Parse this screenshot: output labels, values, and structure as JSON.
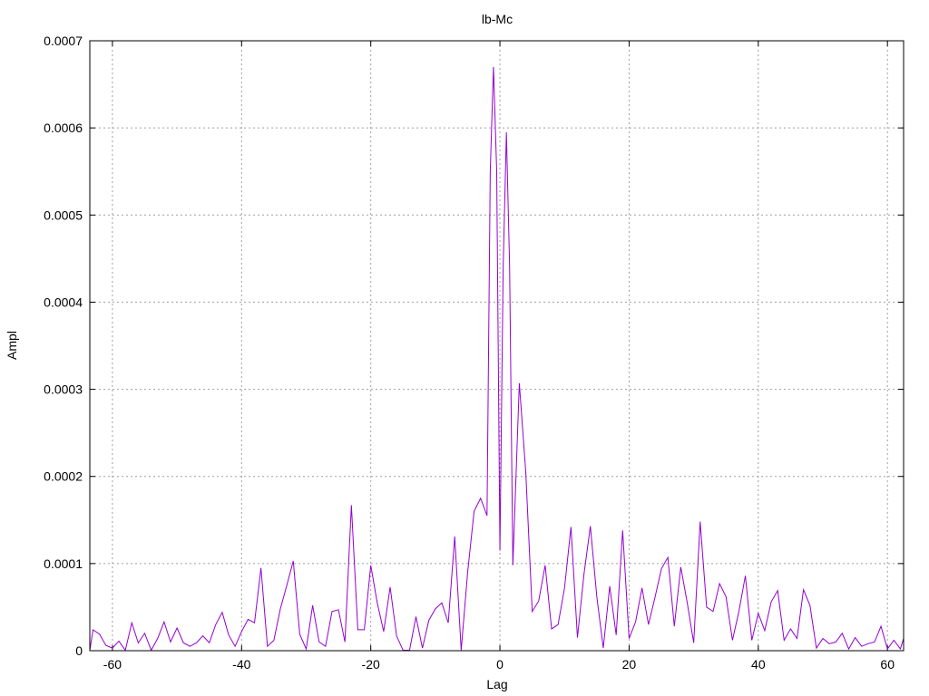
{
  "chart_data": {
    "type": "line",
    "title": "lb-Mc",
    "xlabel": "Lag",
    "ylabel": "Ampl",
    "xlim": [
      -63.5,
      62.5
    ],
    "ylim": [
      0,
      0.0007
    ],
    "grid": true,
    "x_ticks": [
      -60,
      -40,
      -20,
      0,
      20,
      40,
      60
    ],
    "x_tick_labels": [
      "-60",
      "-40",
      "-20",
      "0",
      "20",
      "40",
      "60"
    ],
    "y_ticks": [
      0,
      0.0001,
      0.0002,
      0.0003,
      0.0004,
      0.0005,
      0.0006,
      0.0007
    ],
    "y_tick_labels": [
      "0",
      "0.0001",
      "0.0002",
      "0.0003",
      "0.0004",
      "0.0005",
      "0.0006",
      "0.0007"
    ],
    "line_color": "#9400d3",
    "series": [
      {
        "x": [
          -63.5,
          -63,
          -62,
          -61,
          -60,
          -59,
          -58,
          -57,
          -56,
          -55,
          -54,
          -53,
          -52,
          -51,
          -50,
          -49,
          -48,
          -47,
          -46,
          -45,
          -44,
          -43,
          -42,
          -41,
          -40,
          -39,
          -38,
          -37,
          -36,
          -35,
          -34,
          -33,
          -32,
          -31,
          -30,
          -29,
          -28,
          -27,
          -26,
          -25,
          -24,
          -23,
          -22,
          -21,
          -20,
          -19,
          -18,
          -17,
          -16,
          -15,
          -14,
          -13,
          -12,
          -11,
          -10,
          -9,
          -8,
          -7,
          -6,
          -5,
          -4,
          -3,
          -2,
          -1.5,
          -1,
          -0.5,
          0,
          0.5,
          1,
          1.5,
          2,
          3,
          4,
          5,
          6,
          7,
          8,
          9,
          10,
          11,
          12,
          13,
          14,
          15,
          16,
          17,
          18,
          19,
          20,
          21,
          22,
          23,
          24,
          25,
          26,
          27,
          28,
          29,
          30,
          31,
          32,
          33,
          34,
          35,
          36,
          37,
          38,
          39,
          40,
          41,
          42,
          43,
          44,
          45,
          46,
          47,
          48,
          49,
          50,
          51,
          52,
          53,
          54,
          55,
          56,
          57,
          58,
          59,
          60,
          61,
          62,
          62.5
        ],
        "values": [
          5e-07,
          2.4e-05,
          1.9e-05,
          6e-06,
          3e-06,
          1.1e-05,
          5e-07,
          3.2e-05,
          9e-06,
          2e-05,
          5e-07,
          1.4e-05,
          3.3e-05,
          1e-05,
          2.6e-05,
          9e-06,
          5e-06,
          9e-06,
          1.7e-05,
          9e-06,
          3e-05,
          4.4e-05,
          1.8e-05,
          5e-06,
          2.2e-05,
          3.6e-05,
          3.2e-05,
          9.5e-05,
          5e-06,
          1.2e-05,
          4.8e-05,
          7.5e-05,
          0.000103,
          1.9e-05,
          2e-06,
          5.2e-05,
          1e-05,
          5e-06,
          4.5e-05,
          4.7e-05,
          1e-05,
          0.000167,
          2.4e-05,
          2.4e-05,
          9.8e-05,
          5.5e-05,
          2.2e-05,
          7.3e-05,
          1.7e-05,
          5e-07,
          5e-07,
          3.9e-05,
          3e-06,
          3.5e-05,
          4.8e-05,
          5.5e-05,
          3.2e-05,
          0.000131,
          5e-07,
          9e-05,
          0.00016,
          0.000175,
          0.000155,
          0.00055,
          0.00067,
          0.00055,
          0.000115,
          0.00044,
          0.000595,
          0.00044,
          9.8e-05,
          0.000307,
          0.000205,
          4.5e-05,
          5.7e-05,
          9.8e-05,
          2.5e-05,
          3e-05,
          7.2e-05,
          0.000142,
          1.5e-05,
          8.7e-05,
          0.000143,
          6.2e-05,
          3e-06,
          7.4e-05,
          1.8e-05,
          0.000138,
          1.4e-05,
          3.3e-05,
          7.2e-05,
          3e-05,
          6.1e-05,
          9.4e-05,
          0.000107,
          2.8e-05,
          9.6e-05,
          5.5e-05,
          9e-06,
          0.000148,
          5e-05,
          4.5e-05,
          7.7e-05,
          6.2e-05,
          1.2e-05,
          4.5e-05,
          8.6e-05,
          1.2e-05,
          4.3e-05,
          2.3e-05,
          5.6e-05,
          6.9e-05,
          1.2e-05,
          2.5e-05,
          1.4e-05,
          7e-05,
          5.2e-05,
          3e-06,
          1.4e-05,
          8e-06,
          1e-05,
          2e-05,
          2e-06,
          1.5e-05,
          5e-06,
          8e-06,
          1e-05,
          2.8e-05,
          2e-06,
          1.2e-05,
          2e-06,
          1.4e-05
        ]
      }
    ]
  }
}
